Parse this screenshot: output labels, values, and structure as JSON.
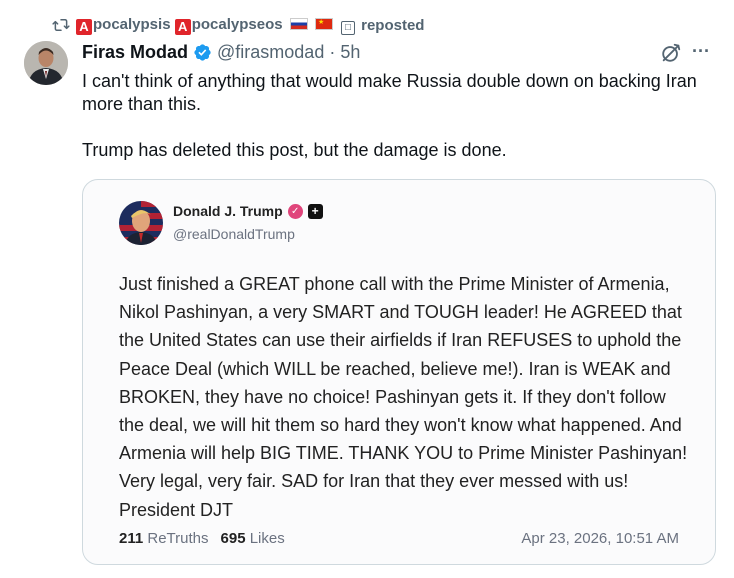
{
  "repost": {
    "name_a1": "pocalypsis",
    "name_a2": "pocalypseos",
    "badge_letter": "A",
    "suffix": "reposted"
  },
  "post": {
    "author_name": "Firas Modad",
    "handle_time": "@firasmodad · 5h",
    "paragraphs": [
      "I can't think of anything that would make Russia double down on backing Iran more than this.",
      "Trump has deleted this post, but the damage is done."
    ]
  },
  "embedded": {
    "author_name": "Donald J. Trump",
    "handle": "@realDonaldTrump",
    "body": "Just finished a GREAT phone call with the Prime Minister of Armenia, Nikol Pashinyan, a very SMART and TOUGH leader! He AGREED that the United States can use their airfields if Iran REFUSES to uphold the Peace Deal (which WILL be reached, believe me!). Iran is WEAK and BROKEN, they have no choice! Pashinyan gets it. If they don't follow the deal, we will hit them so hard they won't know what happened. And Armenia will help BIG TIME. THANK YOU to Prime Minister Pashinyan! Very legal, very fair. SAD for Iran that they ever messed with us! President DJT",
    "retruths_count": "211",
    "retruths_label": "ReTruths",
    "likes_count": "695",
    "likes_label": "Likes",
    "date": "Apr 23, 2026, 10:51 AM"
  },
  "colors": {
    "accent_blue": "#1d9bf0",
    "muted_gray": "#536471",
    "badge_red": "#e0252b"
  },
  "icons": [
    "repost-icon",
    "verified-badge-icon",
    "grok-icon",
    "more-icon",
    "truth-verified-icon",
    "plus-icon"
  ]
}
